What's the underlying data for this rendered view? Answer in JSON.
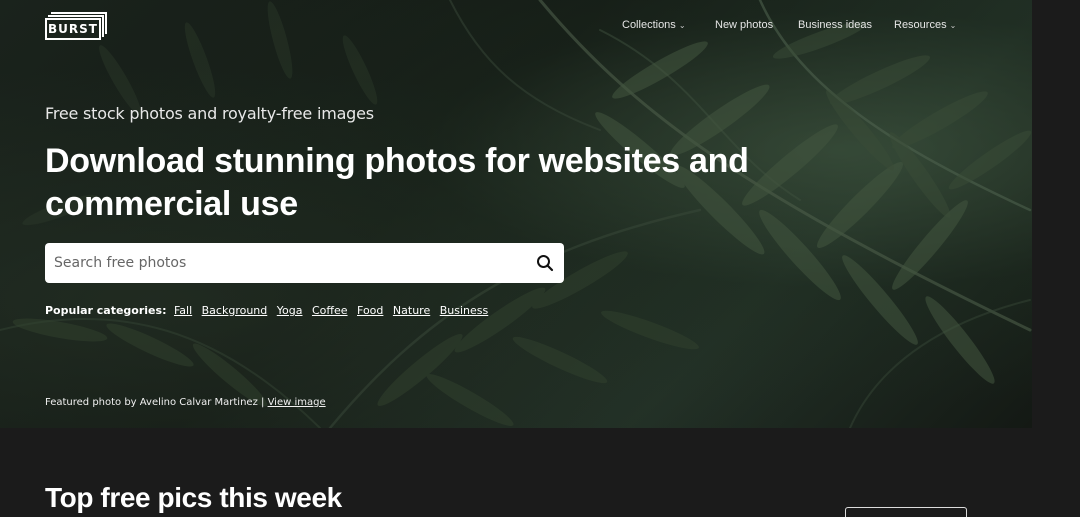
{
  "brand": {
    "logo_text": "BURST"
  },
  "nav": {
    "items": [
      {
        "label": "Collections",
        "has_dropdown": true
      },
      {
        "label": "New photos",
        "has_dropdown": false
      },
      {
        "label": "Business ideas",
        "has_dropdown": false
      },
      {
        "label": "Resources",
        "has_dropdown": true
      }
    ],
    "dropdown_icon": "chevron-down-icon"
  },
  "hero": {
    "subtitle": "Free stock photos and royalty-free images",
    "headline": "Download stunning photos for websites and commercial use",
    "search": {
      "placeholder": "Search free photos",
      "value": "",
      "icon": "search-icon"
    },
    "popular": {
      "label": "Popular categories:",
      "categories": [
        "Fall",
        "Background",
        "Yoga",
        "Coffee",
        "Food",
        "Nature",
        "Business"
      ]
    },
    "credit": {
      "text": "Featured photo by Avelino Calvar Martinez | ",
      "link": "View image"
    }
  },
  "section": {
    "title": "Top free pics this week"
  },
  "colors": {
    "page_bg": "#1b1b1b",
    "hero_tint": "#1a231c",
    "text": "#ffffff",
    "search_bg": "#ffffff"
  }
}
